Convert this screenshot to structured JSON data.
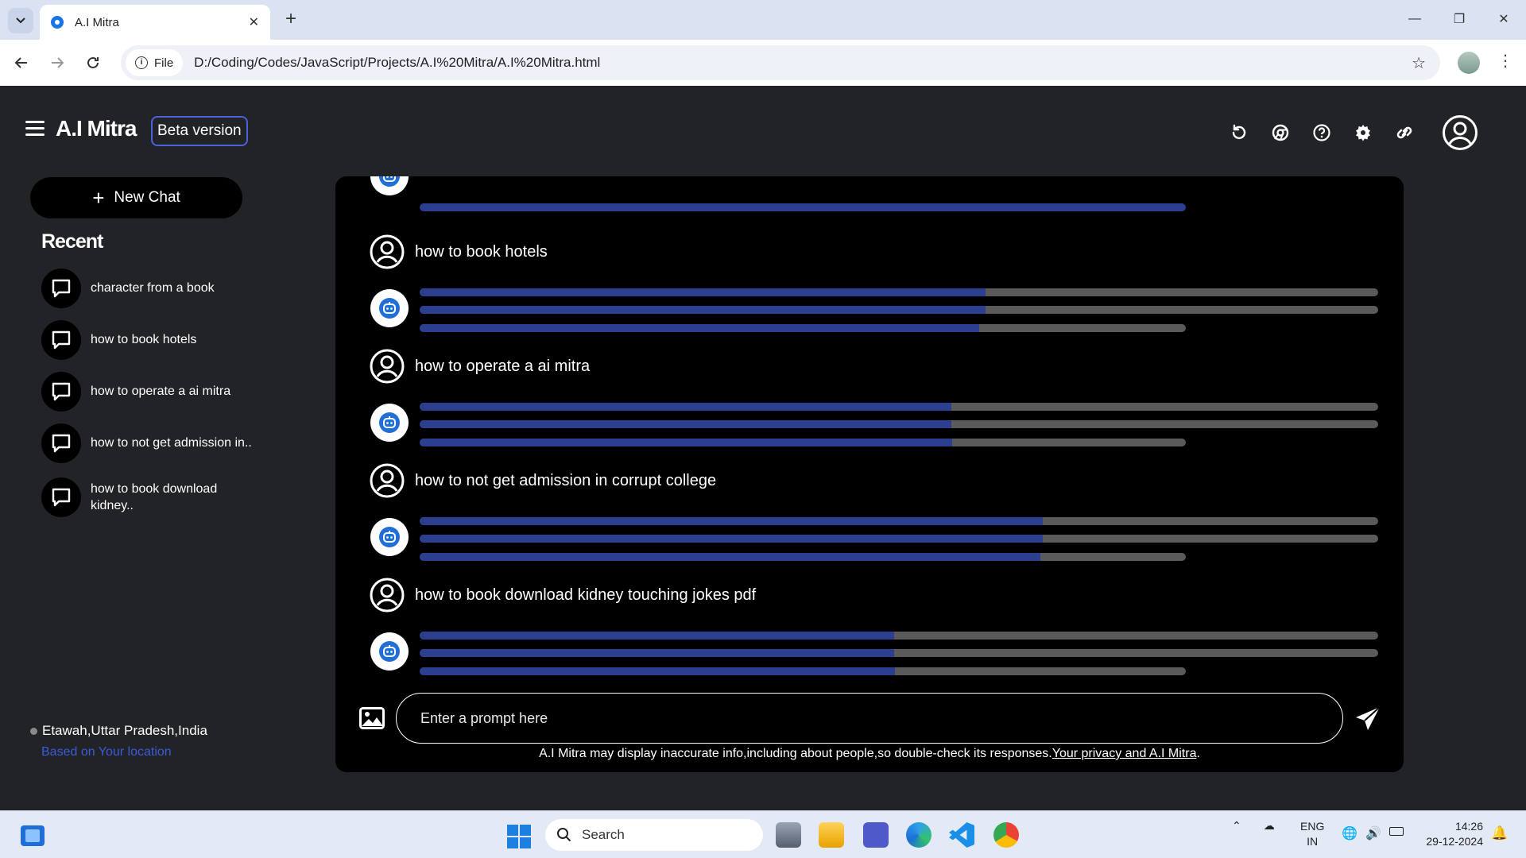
{
  "browser": {
    "tab_title": "A.I Mitra",
    "file_chip": "File",
    "url": "D:/Coding/Codes/JavaScript/Projects/A.I%20Mitra/A.I%20Mitra.html"
  },
  "app": {
    "brand": "A.I Mitra",
    "beta": "Beta version",
    "new_chat": "New Chat",
    "recent_heading": "Recent",
    "recent": [
      {
        "label": "character from a book"
      },
      {
        "label": "how to book hotels"
      },
      {
        "label": "how to operate a ai mitra"
      },
      {
        "label": "how to not get admission in.."
      },
      {
        "label": "how to book download kidney.."
      }
    ],
    "location": "Etawah,Uttar Pradesh,India",
    "location_link": "Based on Your location",
    "messages": [
      {
        "prompt": "how to book hotels"
      },
      {
        "prompt": "how to operate a ai mitra"
      },
      {
        "prompt": "how to not get admission in corrupt college"
      },
      {
        "prompt": "how to book download kidney touching jokes pdf"
      }
    ],
    "input_placeholder": "Enter a prompt here",
    "disclaimer": "A.I Mitra may display inaccurate info,including about people,so double-check its responses.",
    "disclaimer_link": "Your privacy and A.I Mitra",
    "disclaimer_end": ".",
    "accent_color": "#2c3e8f",
    "link_color": "#3b5bdb"
  },
  "taskbar": {
    "search": "Search",
    "lang_top": "ENG",
    "lang_bottom": "IN",
    "time": "14:26",
    "date": "29-12-2024"
  }
}
